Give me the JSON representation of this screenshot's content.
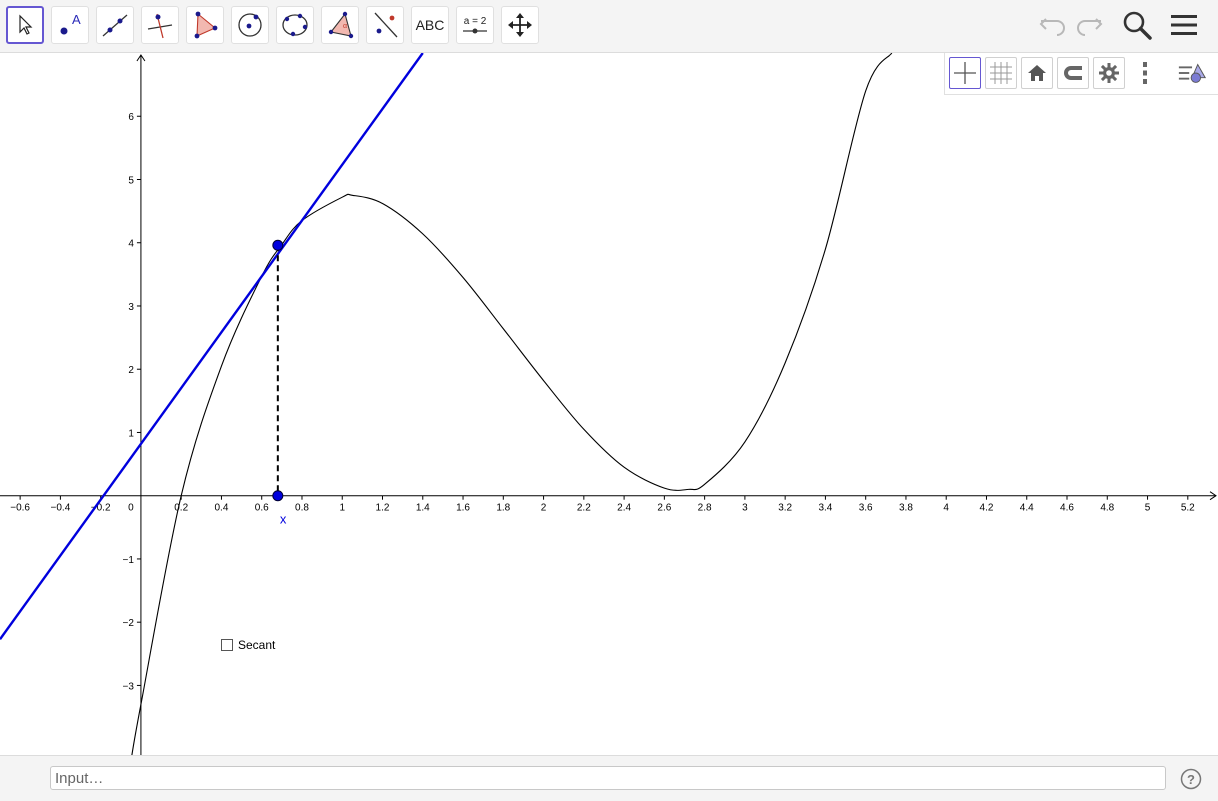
{
  "toolbar": {
    "tools": [
      {
        "name": "move-tool",
        "icon": "arrow-cursor-icon",
        "active": true
      },
      {
        "name": "point-tool",
        "icon": "point-icon"
      },
      {
        "name": "line-tool",
        "icon": "line-through-two-points-icon"
      },
      {
        "name": "perpendicular-line-tool",
        "icon": "perpendicular-line-icon"
      },
      {
        "name": "polygon-tool",
        "icon": "polygon-icon"
      },
      {
        "name": "circle-tool",
        "icon": "circle-center-point-icon"
      },
      {
        "name": "conic-tool",
        "icon": "conic-five-points-icon"
      },
      {
        "name": "angle-tool",
        "icon": "angle-icon"
      },
      {
        "name": "reflect-tool",
        "icon": "reflect-about-line-icon"
      },
      {
        "name": "text-tool",
        "icon": "text-icon",
        "label": "ABC"
      },
      {
        "name": "slider-tool",
        "icon": "slider-icon",
        "label": "a = 2"
      },
      {
        "name": "move-graphics-view-tool",
        "icon": "move-arrows-icon"
      }
    ],
    "right_buttons": [
      "undo-icon",
      "redo-icon",
      "search-icon",
      "menu-icon"
    ]
  },
  "style_bar": {
    "buttons": [
      "axes-icon",
      "grid-icon",
      "home-icon",
      "magnet-icon",
      "gear-icon",
      "more-vertical-icon",
      "toggle-stylebar-icon"
    ]
  },
  "graphics": {
    "x_ticks": [
      "−0.6",
      "−0.4",
      "−0.2",
      "0",
      "0.2",
      "0.4",
      "0.6",
      "0.8",
      "1",
      "1.2",
      "1.4",
      "1.6",
      "1.8",
      "2",
      "2.2",
      "2.4",
      "2.6",
      "2.8",
      "3",
      "3.2",
      "3.4",
      "3.6",
      "3.8",
      "4",
      "4.2",
      "4.4",
      "4.6",
      "4.8",
      "5",
      "5.2"
    ],
    "y_ticks": [
      "6",
      "5",
      "4",
      "3",
      "2",
      "1",
      "−1",
      "−2",
      "−3"
    ],
    "point_label": "x",
    "checkbox_label": "Secant",
    "checkbox_checked": false,
    "colors": {
      "curve": "#000000",
      "tangent": "#0000dd",
      "point": "#0000dd",
      "axis": "#000000"
    }
  },
  "chart_data": {
    "type": "line",
    "title": "",
    "xlabel": "",
    "ylabel": "",
    "xlim": [
      -0.7,
      5.35
    ],
    "ylim": [
      -4.1,
      7.0
    ],
    "grid": false,
    "series": [
      {
        "x": [
          -0.05,
          0.0,
          0.2,
          0.4,
          0.6,
          0.7,
          0.8,
          1.0,
          1.05,
          1.2,
          1.4,
          1.6,
          1.8,
          2.0,
          2.2,
          2.4,
          2.6,
          2.72,
          2.8,
          3.0,
          3.2,
          3.4,
          3.6,
          3.73
        ],
        "values": [
          -4.2,
          -3.3,
          0.0,
          2.05,
          3.47,
          3.97,
          4.35,
          4.72,
          4.75,
          4.62,
          4.14,
          3.45,
          2.64,
          1.82,
          1.05,
          0.45,
          0.12,
          0.1,
          0.18,
          0.85,
          2.1,
          3.9,
          6.4,
          7.0
        ]
      },
      {
        "x": [
          -0.7,
          1.4
        ],
        "values": [
          -2.27,
          7.0
        ]
      }
    ],
    "point": {
      "x": 0.68,
      "y": 3.96
    },
    "foot_point": {
      "x": 0.68,
      "y": 0
    }
  },
  "input_bar": {
    "placeholder": "Input…"
  }
}
